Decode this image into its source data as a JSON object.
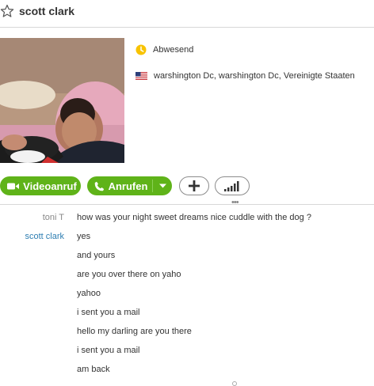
{
  "header": {
    "title": "scott clark",
    "favorite_icon": "star-outline-icon"
  },
  "profile": {
    "photo": "profile-photo",
    "status_icon": "away-clock-icon",
    "status": "Abwesend",
    "status_color": "#f8c300",
    "flag_icon": "us-flag-icon",
    "location": "warshington Dc, warshington Dc, Vereinigte Staaten"
  },
  "actions": {
    "video_label": "Videoanruf",
    "call_label": "Anrufen",
    "add_icon": "plus-icon",
    "signal_icon": "signal-bars-icon",
    "accent_color": "#5fb319"
  },
  "chat": {
    "messages": [
      {
        "sender": "toni T",
        "text": "how was your night sweet dreams nice cuddle with the dog ?"
      },
      {
        "sender": "scott clark",
        "text": "yes"
      },
      {
        "sender": "",
        "text": "and yours"
      },
      {
        "sender": "",
        "text": "are you over there on yaho"
      },
      {
        "sender": "",
        "text": "yahoo"
      },
      {
        "sender": "",
        "text": "i sent you a mail"
      },
      {
        "sender": "",
        "text": "hello my darling are you there"
      },
      {
        "sender": "",
        "text": "i sent you a mail"
      },
      {
        "sender": "",
        "text": "am back"
      }
    ]
  }
}
